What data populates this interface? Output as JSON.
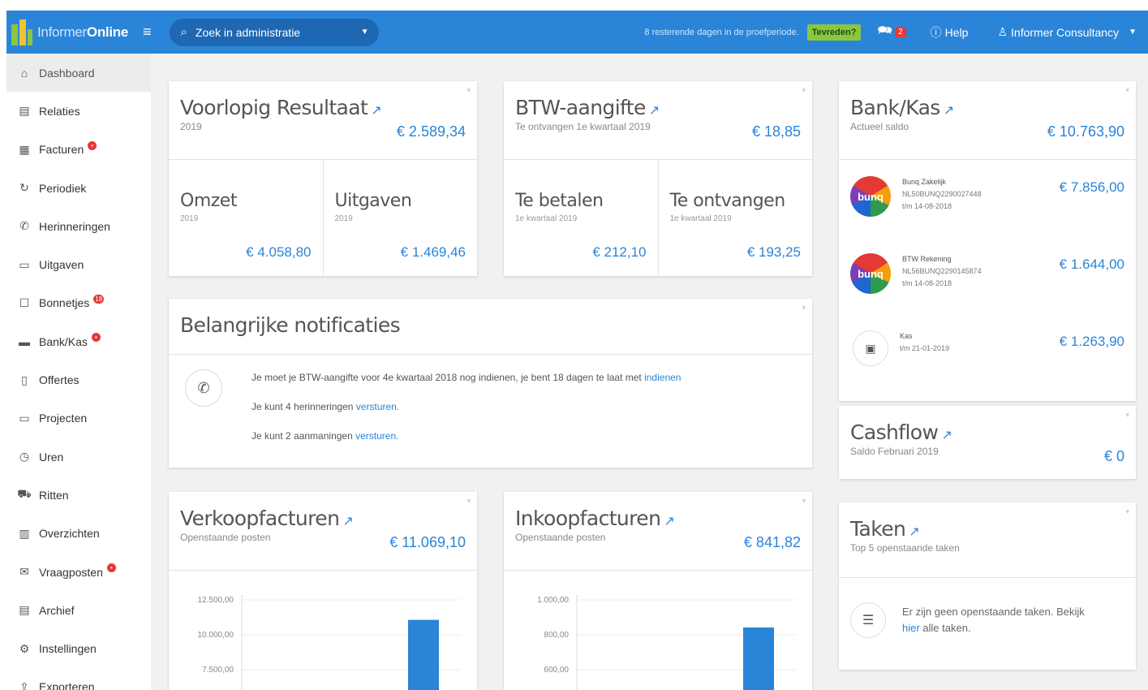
{
  "topbar": {
    "logo_part1": "Informer",
    "logo_part2": "Online",
    "search_placeholder": "Zoek in administratie",
    "trial_text": "8 resterende dagen in de proefperiode.",
    "tevreden_label": "Tevreden?",
    "chat_badge": "2",
    "help_label": "Help",
    "user_label": "Informer Consultancy"
  },
  "sidebar": {
    "items": [
      {
        "label": "Dashboard",
        "icon": "dashboard-icon",
        "glyph": "⌂"
      },
      {
        "label": "Relaties",
        "icon": "contacts-icon",
        "glyph": "▤"
      },
      {
        "label": "Facturen",
        "icon": "invoice-icon",
        "glyph": "▦",
        "badge": "•"
      },
      {
        "label": "Periodiek",
        "icon": "recurring-icon",
        "glyph": "↻"
      },
      {
        "label": "Herinneringen",
        "icon": "reminder-icon",
        "glyph": "✆"
      },
      {
        "label": "Uitgaven",
        "icon": "expenses-icon",
        "glyph": "▭"
      },
      {
        "label": "Bonnetjes",
        "icon": "receipts-icon",
        "glyph": "☐",
        "badge": "18"
      },
      {
        "label": "Bank/Kas",
        "icon": "bank-icon",
        "glyph": "▬",
        "badge": "•"
      },
      {
        "label": "Offertes",
        "icon": "quotes-icon",
        "glyph": "▯"
      },
      {
        "label": "Projecten",
        "icon": "projects-icon",
        "glyph": "▭"
      },
      {
        "label": "Uren",
        "icon": "clock-icon",
        "glyph": "◷"
      },
      {
        "label": "Ritten",
        "icon": "car-icon",
        "glyph": "⛟"
      },
      {
        "label": "Overzichten",
        "icon": "overview-icon",
        "glyph": "▥"
      },
      {
        "label": "Vraagposten",
        "icon": "questions-icon",
        "glyph": "✉",
        "badge": "•"
      },
      {
        "label": "Archief",
        "icon": "archive-icon",
        "glyph": "▤"
      },
      {
        "label": "Instellingen",
        "icon": "settings-icon",
        "glyph": "⚙"
      },
      {
        "label": "Exporteren",
        "icon": "export-icon",
        "glyph": "⇪"
      }
    ]
  },
  "voorlopig": {
    "title": "Voorlopig Resultaat",
    "subtitle": "2019",
    "amount": "€ 2.589,34",
    "left_label": "Omzet",
    "left_sub": "2019",
    "left_value": "€ 4.058,80",
    "right_label": "Uitgaven",
    "right_sub": "2019",
    "right_value": "€ 1.469,46"
  },
  "btw": {
    "title": "BTW-aangifte",
    "subtitle": "Te ontvangen 1e kwartaal 2019",
    "amount": "€ 18,85",
    "left_label": "Te betalen",
    "left_sub": "1e kwartaal 2019",
    "left_value": "€ 212,10",
    "right_label": "Te ontvangen",
    "right_sub": "1e kwartaal 2019",
    "right_value": "€ 193,25"
  },
  "notificaties": {
    "title": "Belangrijke notificaties",
    "line1_text": "Je moet je BTW-aangifte voor 4e kwartaal 2018 nog indienen, je bent 18 dagen te laat met ",
    "line1_link": "indienen",
    "line2_text": "Je kunt 4 herinneringen ",
    "line2_link": "versturen.",
    "line3_text": "Je kunt 2 aanmaningen ",
    "line3_link": "versturen."
  },
  "verkoop": {
    "title": "Verkoopfacturen",
    "subtitle": "Openstaande posten",
    "amount": "€ 11.069,10"
  },
  "inkoop": {
    "title": "Inkoopfacturen",
    "subtitle": "Openstaande posten",
    "amount": "€ 841,82"
  },
  "bank": {
    "title": "Bank/Kas",
    "subtitle": "Actueel saldo",
    "amount": "€ 10.763,90",
    "accounts": [
      {
        "name": "Bunq Zakelijk",
        "iban": "NL50BUNQ2290027448",
        "date": "t/m 14-08-2018",
        "amount": "€ 7.856,00",
        "logo": "bunq"
      },
      {
        "name": "BTW Rekening",
        "iban": "NL56BUNQ2290145874",
        "date": "t/m 14-08-2018",
        "amount": "€ 1.644,00",
        "logo": "bunq"
      },
      {
        "name": "Kas",
        "iban": "",
        "date": "t/m 21-01-2019",
        "amount": "€ 1.263,90",
        "logo": "kas"
      }
    ]
  },
  "cashflow": {
    "title": "Cashflow",
    "subtitle": "Saldo Februari 2019",
    "amount": "€ 0"
  },
  "taken": {
    "title": "Taken",
    "subtitle": "Top 5 openstaande taken",
    "text": "Er zijn geen openstaande taken. Bekijk",
    "link": "hier",
    "text2": " alle taken."
  },
  "chart_data": [
    {
      "type": "bar",
      "title": "",
      "y_ticks": [
        "12.500,00",
        "10.000,00",
        "7.500,00"
      ],
      "values": [
        11069.1
      ],
      "ylim": [
        0,
        12500
      ]
    },
    {
      "type": "bar",
      "title": "",
      "y_ticks": [
        "1.000,00",
        "800,00",
        "600,00"
      ],
      "values": [
        841.82
      ],
      "ylim": [
        0,
        1000
      ]
    }
  ],
  "colors": {
    "brand": "#2a84d8",
    "accent_green": "#8cc63f",
    "badge_red": "#e53935"
  }
}
